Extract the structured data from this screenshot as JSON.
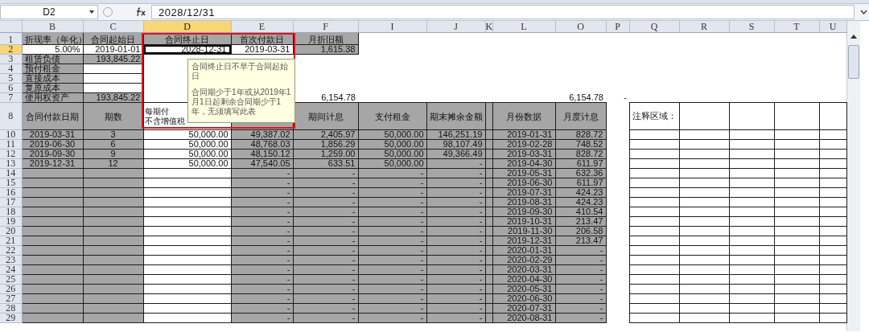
{
  "formula_bar": {
    "name_box": "D2",
    "formula": "2028/12/31"
  },
  "columns": [
    {
      "letter": "B",
      "selected": false
    },
    {
      "letter": "C",
      "selected": false
    },
    {
      "letter": "D",
      "selected": true
    },
    {
      "letter": "E",
      "selected": false
    },
    {
      "letter": "F",
      "selected": false
    },
    {
      "letter": "I",
      "selected": false
    },
    {
      "letter": "J",
      "selected": false
    },
    {
      "letter": "K",
      "selected": false
    },
    {
      "letter": "L",
      "selected": false
    },
    {
      "letter": "O",
      "selected": false
    },
    {
      "letter": "P",
      "selected": false
    },
    {
      "letter": "Q",
      "selected": false
    },
    {
      "letter": "R",
      "selected": false
    },
    {
      "letter": "S",
      "selected": false
    },
    {
      "letter": "T",
      "selected": false
    },
    {
      "letter": "U",
      "selected": false
    }
  ],
  "summary_rows": [
    {
      "number": "1",
      "selected": false,
      "cells": [
        {
          "text": "折现率（年化）",
          "shaded": true,
          "boxed": true
        },
        {
          "text": "合同起始日",
          "shaded": true,
          "boxed": true
        },
        {
          "text": "合同终止日",
          "shaded": true,
          "boxed": true
        },
        {
          "text": "首次付款日",
          "shaded": true,
          "boxed": true
        },
        {
          "text": "月折旧额",
          "shaded": true,
          "boxed": true
        },
        null,
        null,
        null,
        null,
        null,
        null,
        null,
        null,
        null,
        null,
        null
      ]
    },
    {
      "number": "2",
      "selected": true,
      "cells": [
        {
          "text": "5.00%",
          "shaded": false,
          "boxed": true
        },
        {
          "text": "2019-01-01",
          "shaded": false,
          "boxed": true
        },
        {
          "text": "2028-12-31",
          "shaded": false,
          "boxed": true
        },
        {
          "text": "2019-03-31",
          "shaded": false,
          "boxed": true
        },
        {
          "text": "1,615.38",
          "shaded": true,
          "boxed": true
        },
        null,
        null,
        null,
        null,
        null,
        null,
        null,
        null,
        null,
        null,
        null
      ]
    },
    {
      "number": "3",
      "selected": false,
      "cells": [
        {
          "text": "租赁负债",
          "shaded": true,
          "boxed": true
        },
        {
          "text": "193,845.22",
          "shaded": true,
          "boxed": true
        },
        null,
        null,
        null,
        null,
        null,
        null,
        null,
        null,
        null,
        null,
        null,
        null,
        null,
        null
      ]
    },
    {
      "number": "4",
      "selected": false,
      "cells": [
        {
          "text": "预付租金",
          "shaded": true,
          "boxed": true
        },
        {
          "shaded": false,
          "boxed": true
        },
        null,
        null,
        null,
        null,
        null,
        null,
        null,
        null,
        null,
        null,
        null,
        null,
        null,
        null
      ]
    },
    {
      "number": "5",
      "selected": false,
      "cells": [
        {
          "text": "直接成本",
          "shaded": true,
          "boxed": true
        },
        {
          "shaded": false,
          "boxed": true
        },
        null,
        null,
        null,
        null,
        null,
        null,
        null,
        null,
        null,
        null,
        null,
        null,
        null,
        null
      ]
    },
    {
      "number": "6",
      "selected": false,
      "cells": [
        {
          "text": "复原成本",
          "shaded": true,
          "boxed": true
        },
        {
          "shaded": false,
          "boxed": true
        },
        null,
        null,
        null,
        null,
        null,
        null,
        null,
        null,
        null,
        null,
        null,
        null,
        null,
        null
      ]
    },
    {
      "number": "7",
      "selected": false,
      "cells": [
        {
          "text": "使用权资产",
          "shaded": true,
          "boxed": true
        },
        {
          "text": "193,845.22",
          "shaded": true,
          "boxed": true
        },
        null,
        null,
        {
          "text": "6,154.78",
          "shaded": false,
          "boxed": false
        },
        null,
        null,
        null,
        null,
        {
          "text": "6,154.78",
          "shaded": false,
          "boxed": false
        },
        {
          "text": "-",
          "shaded": false,
          "boxed": false
        },
        null,
        null,
        null,
        null,
        null
      ]
    }
  ],
  "table": {
    "header_row": "8",
    "columns": [
      {
        "heading": [
          "合同付款日期"
        ],
        "shaded": true
      },
      {
        "heading": [
          "期数"
        ],
        "shaded": true
      },
      {
        "heading": [
          "每期付",
          "不含增值税"
        ],
        "shaded": false
      },
      {
        "shaded": true
      },
      {
        "heading": [
          "期间计息"
        ],
        "shaded": true
      },
      {
        "heading": [
          "支付租金"
        ],
        "shaded": true
      },
      {
        "heading": [
          "期末摊余金额"
        ],
        "shaded": true
      },
      {
        "shaded": true
      },
      {
        "heading": [
          "月份数据"
        ],
        "shaded": true
      },
      {
        "heading": [
          "月度计息"
        ],
        "shaded": true
      }
    ],
    "rows": [
      {
        "number": "10",
        "cells": [
          "2019-03-31",
          "3",
          "50,000.00",
          "49,387.02",
          "2,405.97",
          "50,000.00",
          "146,251.19",
          null,
          "2019-01-31",
          "828.72"
        ]
      },
      {
        "number": "11",
        "cells": [
          "2019-06-30",
          "6",
          "50,000.00",
          "48,768.03",
          "1,856.29",
          "50,000.00",
          "98,107.49",
          null,
          "2019-02-28",
          "748.52"
        ]
      },
      {
        "number": "12",
        "cells": [
          "2019-09-30",
          "9",
          "50,000.00",
          "48,150.12",
          "1,259.00",
          "50,000.00",
          "49,366.49",
          null,
          "2019-03-31",
          "828.72"
        ]
      },
      {
        "number": "13",
        "cells": [
          "2019-12-31",
          "12",
          "50,000.00",
          "47,540.05",
          "633.51",
          "50,000.00",
          "-",
          null,
          "2019-04-30",
          "611.97"
        ]
      },
      {
        "number": "14",
        "cells": [
          null,
          null,
          null,
          "-",
          "-",
          "-",
          "-",
          null,
          "2019-05-31",
          "632.36"
        ]
      },
      {
        "number": "15",
        "cells": [
          null,
          null,
          null,
          "-",
          "-",
          "-",
          "-",
          null,
          "2019-06-30",
          "611.97"
        ]
      },
      {
        "number": "16",
        "cells": [
          null,
          null,
          null,
          "-",
          "-",
          "-",
          "-",
          null,
          "2019-07-31",
          "424.23"
        ]
      },
      {
        "number": "17",
        "cells": [
          null,
          null,
          null,
          "-",
          "-",
          "-",
          "-",
          null,
          "2019-08-31",
          "424.23"
        ]
      },
      {
        "number": "18",
        "cells": [
          null,
          null,
          null,
          "-",
          "-",
          "-",
          "-",
          null,
          "2019-09-30",
          "410.54"
        ]
      },
      {
        "number": "19",
        "cells": [
          null,
          null,
          null,
          "-",
          "-",
          "-",
          "-",
          null,
          "2019-10-31",
          "213.47"
        ]
      },
      {
        "number": "20",
        "cells": [
          null,
          null,
          null,
          "-",
          "-",
          "-",
          "-",
          null,
          "2019-11-30",
          "206.58"
        ]
      },
      {
        "number": "21",
        "cells": [
          null,
          null,
          null,
          "-",
          "-",
          "-",
          "-",
          null,
          "2019-12-31",
          "213.47"
        ]
      },
      {
        "number": "22",
        "cells": [
          null,
          null,
          null,
          "-",
          "-",
          "-",
          "-",
          null,
          "2020-01-31",
          "-"
        ]
      },
      {
        "number": "23",
        "cells": [
          null,
          null,
          null,
          "-",
          "-",
          "-",
          "-",
          null,
          "2020-02-29",
          "-"
        ]
      },
      {
        "number": "24",
        "cells": [
          null,
          null,
          null,
          "-",
          "-",
          "-",
          "-",
          null,
          "2020-03-31",
          "-"
        ]
      },
      {
        "number": "25",
        "cells": [
          null,
          null,
          null,
          "-",
          "-",
          "-",
          "-",
          null,
          "2020-04-30",
          "-"
        ]
      },
      {
        "number": "26",
        "cells": [
          null,
          null,
          null,
          "-",
          "-",
          "-",
          "-",
          null,
          "2020-05-31",
          "-"
        ]
      },
      {
        "number": "27",
        "cells": [
          null,
          null,
          null,
          "-",
          "-",
          "-",
          "-",
          null,
          "2020-06-30",
          "-"
        ]
      },
      {
        "number": "28",
        "cells": [
          null,
          null,
          null,
          "-",
          "-",
          "-",
          "-",
          null,
          "2020-07-31",
          "-"
        ]
      },
      {
        "number": "29",
        "cells": [
          null,
          null,
          null,
          "-",
          "-",
          "-",
          "-",
          null,
          "2020-08-31",
          "-"
        ]
      }
    ]
  },
  "notes": {
    "heading": "注释区域："
  },
  "comment": {
    "paragraphs": [
      "合同终止日不早于合同起始日",
      "合同期少于1年或从2019年1月1日起剩余合同期少于1年，无须填写此表"
    ]
  }
}
